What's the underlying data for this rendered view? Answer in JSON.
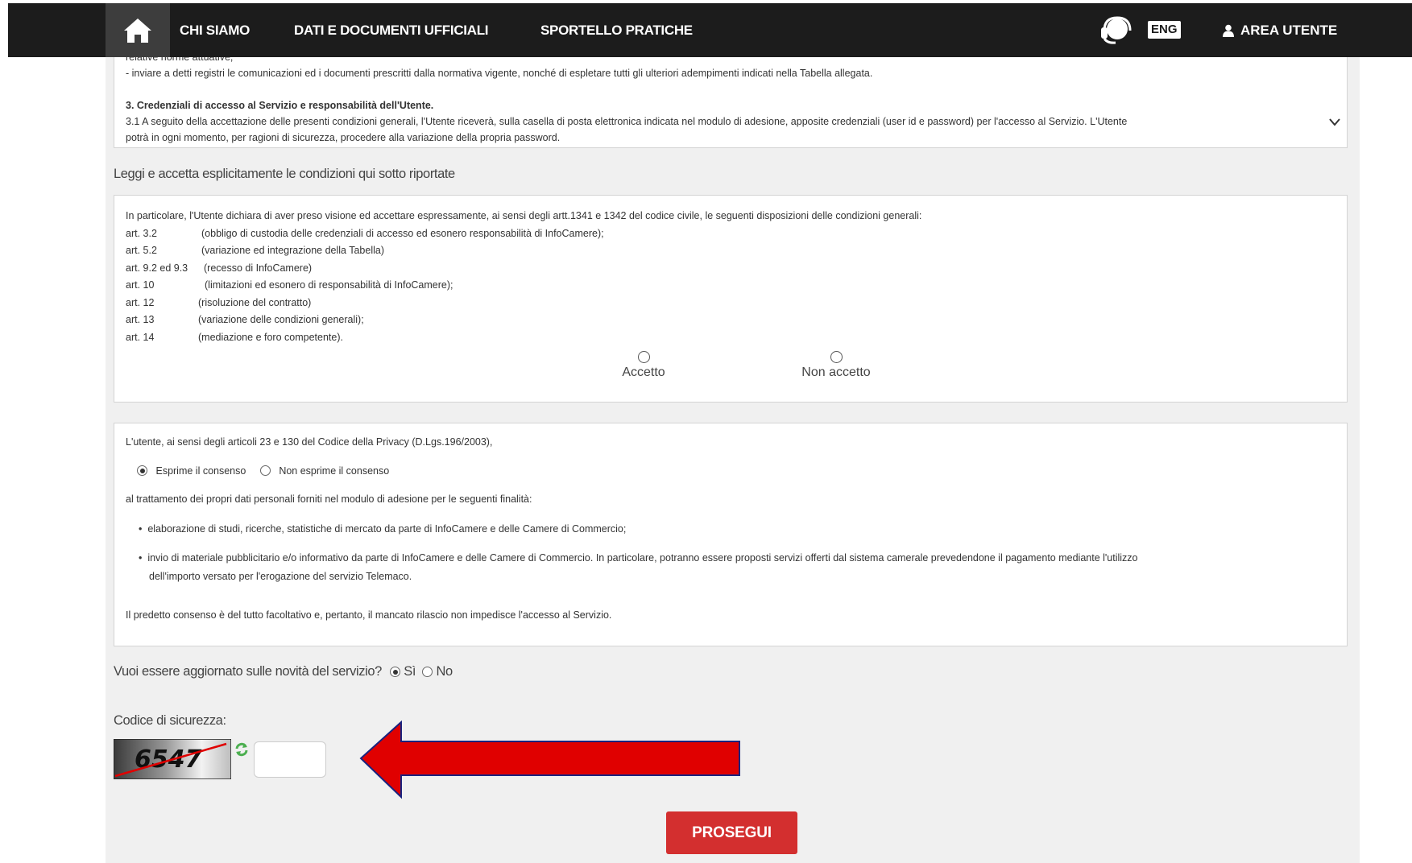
{
  "nav": {
    "home_icon": "home-icon",
    "items": [
      "CHI SIAMO",
      "DATI E DOCUMENTI UFFICIALI",
      "SPORTELLO PRATICHE"
    ],
    "help_icon": "headset-icon",
    "lang": "ENG",
    "user_icon": "user-icon",
    "area_utente": "AREA UTENTE"
  },
  "conditions_scroll": {
    "lines": [
      "relative norme attuative;",
      "- inviare a detti registri le comunicazioni ed i documenti prescritti dalla normativa vigente, nonché di espletare tutti gli ulteriori adempimenti indicati nella Tabella allegata.",
      "",
      "3. Credenziali di accesso al Servizio e responsabilità dell'Utente.",
      "3.1 A seguito della accettazione delle presenti condizioni generali, l'Utente riceverà, sulla casella di posta elettronica indicata nel modulo di adesione, apposite credenziali (user id e password) per l'accesso al Servizio. L'Utente",
      "potrà in ogni momento, per ragioni di sicurezza, procedere alla variazione della propria password."
    ]
  },
  "explicit": {
    "heading": "Leggi e accetta esplicitamente le condizioni qui sotto riportate",
    "intro": "In particolare, l'Utente dichiara di aver preso visione ed accettare espressamente, ai sensi degli artt.1341 e 1342 del codice civile, le seguenti disposizioni delle condizioni generali:",
    "articles": [
      {
        "art": "art. 3.2",
        "desc": "(obbligo di custodia delle credenziali di accesso ed esonero responsabilità di InfoCamere);"
      },
      {
        "art": "art. 5.2",
        "desc": "(variazione ed integrazione della Tabella)"
      },
      {
        "art": "art. 9.2 ed 9.3",
        "desc": "(recesso di InfoCamere)"
      },
      {
        "art": "art. 10",
        "desc": "(limitazioni ed esonero di responsabilità di InfoCamere);"
      },
      {
        "art": "art. 12",
        "desc": "(risoluzione del contratto)"
      },
      {
        "art": "art. 13",
        "desc": "(variazione delle condizioni generali);"
      },
      {
        "art": "art. 14",
        "desc": "(mediazione e foro competente)."
      }
    ],
    "accept_label": "Accetto",
    "reject_label": "Non accetto"
  },
  "privacy": {
    "intro": "L'utente, ai sensi degli articoli 23 e 130 del Codice della Privacy (D.Lgs.196/2003),",
    "consent_yes": "Esprime il consenso",
    "consent_no": "Non esprime il consenso",
    "purpose_intro": "al trattamento dei propri dati personali forniti nel modulo di adesione per le seguenti finalità:",
    "bullet1": "elaborazione di studi, ricerche, statistiche di mercato da parte di InfoCamere e delle Camere di Commercio;",
    "bullet2_line1": "invio di materiale pubblicitario e/o informativo da parte di InfoCamere e delle Camere di Commercio. In particolare, potranno essere proposti servizi offerti dal sistema camerale prevedendone il pagamento mediante l'utilizzo",
    "bullet2_line2": "dell'importo versato per l'erogazione del servizio Telemaco.",
    "footer": "Il predetto consenso è del tutto facoltativo e, pertanto, il mancato rilascio non impedisce l'accesso al Servizio."
  },
  "updates": {
    "question": "Vuoi essere aggiornato sulle novità del servizio?",
    "yes": "Sì",
    "no": "No"
  },
  "security": {
    "label": "Codice di sicurezza:",
    "captcha_text": "6547",
    "refresh_icon": "refresh-icon",
    "input_value": ""
  },
  "submit_label": "PROSEGUI",
  "colors": {
    "nav_bg": "#1c1c1c",
    "button": "#d32f2f",
    "arrow": "#e00000"
  }
}
